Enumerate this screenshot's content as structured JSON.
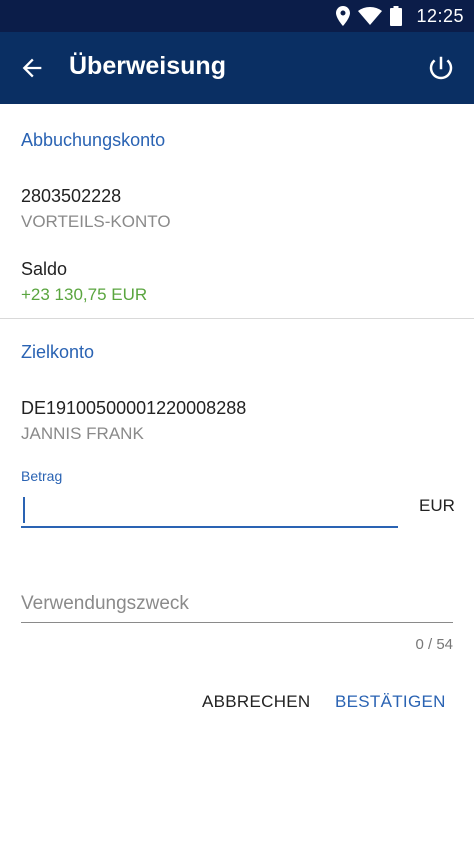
{
  "status_bar": {
    "time": "12:25",
    "icons": [
      "location-icon",
      "wifi-icon",
      "battery-icon"
    ]
  },
  "app_bar": {
    "title": "Überweisung",
    "back_icon": "arrow-left-icon",
    "power_icon": "power-icon",
    "color": "#0a2f63"
  },
  "debit_account": {
    "section_title": "Abbuchungskonto",
    "number": "2803502228",
    "name": "VORTEILS-KONTO",
    "balance_label": "Saldo",
    "balance_value": "+23 130,75 EUR"
  },
  "target_account": {
    "section_title": "Zielkonto",
    "iban": "DE19100500001220008288",
    "holder": "JANNIS FRANK"
  },
  "amount": {
    "label": "Betrag",
    "value": "",
    "currency": "EUR"
  },
  "purpose": {
    "placeholder": "Verwendungszweck",
    "value": "",
    "counter": "0 / 54"
  },
  "actions": {
    "cancel_label": "ABBRECHEN",
    "confirm_label": "BESTÄTIGEN"
  },
  "colors": {
    "accent": "#2a63b3",
    "positive": "#5aa53f",
    "status_bar": "#0b1d49"
  }
}
